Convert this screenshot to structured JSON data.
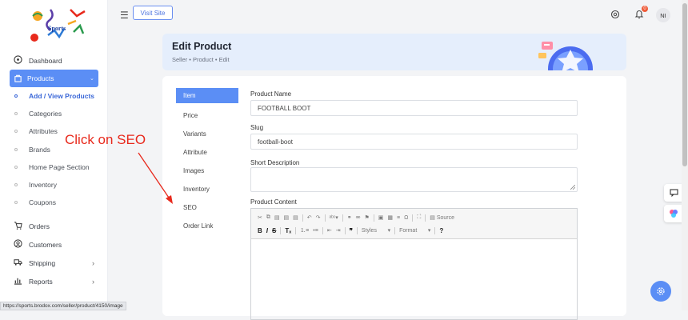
{
  "topbar": {
    "visit_site": "Visit Site",
    "notification_count": "0",
    "avatar_initials": "NI"
  },
  "logo": {
    "text": "Sports"
  },
  "sidebar": {
    "items": [
      {
        "label": "Dashboard",
        "icon": "dashboard-icon"
      },
      {
        "label": "Products",
        "icon": "products-icon",
        "active": true
      },
      {
        "label": "Orders",
        "icon": "cart-icon"
      },
      {
        "label": "Customers",
        "icon": "user-icon"
      },
      {
        "label": "Shipping",
        "icon": "truck-icon"
      },
      {
        "label": "Reports",
        "icon": "chart-icon"
      }
    ],
    "subitems": [
      "Add / View Products",
      "Categories",
      "Attributes",
      "Brands",
      "Home Page Section",
      "Inventory",
      "Coupons"
    ]
  },
  "header": {
    "title": "Edit Product",
    "breadcrumb": "Seller • Product • Edit"
  },
  "tabs": [
    "Item",
    "Price",
    "Variants",
    "Attribute",
    "Images",
    "Inventory",
    "SEO",
    "Order Link"
  ],
  "form": {
    "product_name_label": "Product Name",
    "product_name_value": "FOOTBALL BOOT",
    "slug_label": "Slug",
    "slug_value": "football-boot",
    "short_desc_label": "Short Description",
    "content_label": "Product Content"
  },
  "editor": {
    "source_label": "Source",
    "styles_label": "Styles",
    "format_label": "Format"
  },
  "annotation": "Click on SEO",
  "status_url": "https://sports.brodox.com/seller/product/4150/image",
  "colors": {
    "accent": "#5b8ef5",
    "annotation": "#e8291c",
    "header_bg": "#e5eefc"
  }
}
